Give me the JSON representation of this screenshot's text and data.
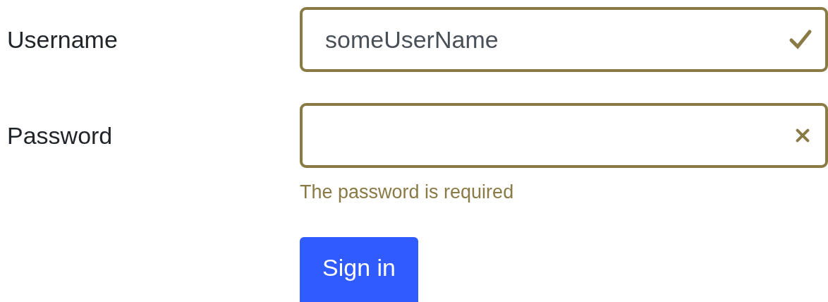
{
  "fields": [
    {
      "label": "Username",
      "value": "someUserName",
      "valid": true
    },
    {
      "label": "Password",
      "valid": false,
      "feedback": "The password is required"
    }
  ],
  "submit": {
    "label": "Sign in"
  }
}
